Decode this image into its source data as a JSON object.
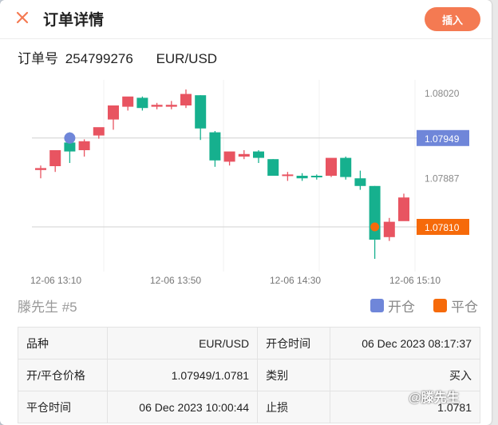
{
  "header": {
    "title": "订单详情",
    "insert_label": "插入"
  },
  "order": {
    "label": "订单号",
    "number": "254799276",
    "symbol": "EUR/USD"
  },
  "chart_data": {
    "type": "candlestick",
    "x_labels": [
      "12-06 13:10",
      "12-06 13:50",
      "12-06 14:30",
      "12-06 15:10"
    ],
    "y_ticks": [
      1.0802,
      1.07887
    ],
    "y_tick_labels": [
      "1.08020",
      "1.07887"
    ],
    "ylim": [
      1.0774,
      1.0804
    ],
    "candles": [
      {
        "o": 1.07899,
        "h": 1.07906,
        "l": 1.07886,
        "c": 1.07902
      },
      {
        "o": 1.07905,
        "h": 1.07925,
        "l": 1.07896,
        "c": 1.0793
      },
      {
        "o": 1.07942,
        "h": 1.07958,
        "l": 1.0791,
        "c": 1.07928
      },
      {
        "o": 1.0793,
        "h": 1.07947,
        "l": 1.0792,
        "c": 1.07944
      },
      {
        "o": 1.07953,
        "h": 1.0796,
        "l": 1.07948,
        "c": 1.07966
      },
      {
        "o": 1.07978,
        "h": 1.07988,
        "l": 1.07962,
        "c": 1.08
      },
      {
        "o": 1.07998,
        "h": 1.08012,
        "l": 1.07992,
        "c": 1.08014
      },
      {
        "o": 1.08012,
        "h": 1.08014,
        "l": 1.07992,
        "c": 1.07996
      },
      {
        "o": 1.07998,
        "h": 1.08004,
        "l": 1.07994,
        "c": 1.08001
      },
      {
        "o": 1.07998,
        "h": 1.08007,
        "l": 1.07994,
        "c": 1.08001
      },
      {
        "o": 1.08,
        "h": 1.08025,
        "l": 1.07996,
        "c": 1.08018
      },
      {
        "o": 1.08016,
        "h": 1.08016,
        "l": 1.07946,
        "c": 1.07964
      },
      {
        "o": 1.07958,
        "h": 1.0796,
        "l": 1.07904,
        "c": 1.07914
      },
      {
        "o": 1.07912,
        "h": 1.07926,
        "l": 1.07906,
        "c": 1.07928
      },
      {
        "o": 1.0792,
        "h": 1.0793,
        "l": 1.07916,
        "c": 1.07924
      },
      {
        "o": 1.07928,
        "h": 1.0793,
        "l": 1.0791,
        "c": 1.07918
      },
      {
        "o": 1.07916,
        "h": 1.07916,
        "l": 1.0789,
        "c": 1.0789
      },
      {
        "o": 1.0789,
        "h": 1.07896,
        "l": 1.07882,
        "c": 1.07892
      },
      {
        "o": 1.0789,
        "h": 1.07894,
        "l": 1.07882,
        "c": 1.07886
      },
      {
        "o": 1.0789,
        "h": 1.07892,
        "l": 1.07884,
        "c": 1.07888
      },
      {
        "o": 1.0789,
        "h": 1.07912,
        "l": 1.07888,
        "c": 1.07918
      },
      {
        "o": 1.07918,
        "h": 1.0792,
        "l": 1.07884,
        "c": 1.07888
      },
      {
        "o": 1.07886,
        "h": 1.07898,
        "l": 1.07868,
        "c": 1.07874
      },
      {
        "o": 1.07874,
        "h": 1.07874,
        "l": 1.0776,
        "c": 1.0779
      },
      {
        "o": 1.07794,
        "h": 1.07824,
        "l": 1.07788,
        "c": 1.07818
      },
      {
        "o": 1.07819,
        "h": 1.07862,
        "l": 1.0782,
        "c": 1.07856
      }
    ],
    "open_marker": {
      "candle_index": 2,
      "price": 1.07949,
      "label": "1.07949"
    },
    "close_marker": {
      "candle_index": 23,
      "price": 1.0781,
      "label": "1.07810"
    },
    "colors": {
      "up": "#e85461",
      "down": "#16b08e",
      "open": "#6f86d9",
      "close": "#f66a0a"
    }
  },
  "info": {
    "owner": "滕先生 #5",
    "legend_open": "开仓",
    "legend_close": "平仓",
    "rows": [
      {
        "k1": "品种",
        "v1": "EUR/USD",
        "k2": "开仓时间",
        "v2": "06 Dec 2023 08:17:37"
      },
      {
        "k1": "开/平仓价格",
        "v1": "1.07949/1.0781",
        "k2": "类别",
        "v2": "买入"
      },
      {
        "k1": "平仓时间",
        "v1": "06 Dec 2023 10:00:44",
        "k2": "止损",
        "v2": "1.0781"
      }
    ]
  },
  "watermark": "@滕先生",
  "colors": {
    "accent": "#f47a52",
    "open": "#6f86d9",
    "close": "#f66a0a"
  }
}
